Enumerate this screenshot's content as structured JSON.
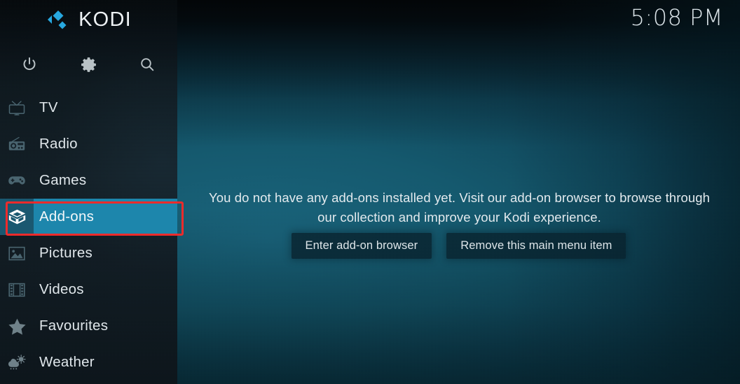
{
  "app": {
    "name": "KODI",
    "logo_icon": "kodi-logo-icon",
    "logo_color": "#27a8e0"
  },
  "clock": {
    "time": "5:08 PM"
  },
  "toolbar": {
    "buttons": [
      {
        "name": "power",
        "icon": "power-icon",
        "label": "Power"
      },
      {
        "name": "settings",
        "icon": "gear-icon",
        "label": "Settings"
      },
      {
        "name": "search",
        "icon": "search-icon",
        "label": "Search"
      }
    ]
  },
  "sidebar": {
    "items": [
      {
        "label": "TV",
        "icon": "tv-icon",
        "selected": false
      },
      {
        "label": "Radio",
        "icon": "radio-icon",
        "selected": false
      },
      {
        "label": "Games",
        "icon": "gamepad-icon",
        "selected": false
      },
      {
        "label": "Add-ons",
        "icon": "addons-box-icon",
        "selected": true
      },
      {
        "label": "Pictures",
        "icon": "picture-icon",
        "selected": false
      },
      {
        "label": "Videos",
        "icon": "filmstrip-icon",
        "selected": false
      },
      {
        "label": "Favourites",
        "icon": "star-icon",
        "selected": false
      },
      {
        "label": "Weather",
        "icon": "weather-icon",
        "selected": false
      }
    ],
    "selected_index": 3,
    "highlight_color": "#1d86ac",
    "highlight_icon_color": "#1a5870"
  },
  "annotation": {
    "color": "#ee2b2b",
    "target": "Add-ons"
  },
  "main": {
    "message": "You do not have any add-ons installed yet. Visit our add-on browser to browse through our collection and improve your Kodi experience.",
    "buttons": [
      {
        "label": "Enter add-on browser"
      },
      {
        "label": "Remove this main menu item"
      }
    ]
  }
}
